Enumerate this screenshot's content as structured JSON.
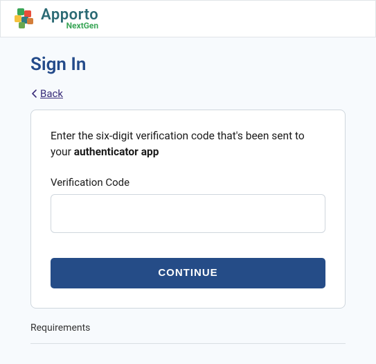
{
  "brand": {
    "name": "Apporto",
    "sub": "NextGen"
  },
  "page": {
    "title": "Sign In",
    "back_label": "Back"
  },
  "card": {
    "instruction_prefix": "Enter the six-digit verification code that's been sent to your ",
    "instruction_bold": "authenticator app",
    "field_label": "Verification Code",
    "code_value": "",
    "continue_label": "CONTINUE"
  },
  "footer": {
    "requirements_label": "Requirements"
  }
}
